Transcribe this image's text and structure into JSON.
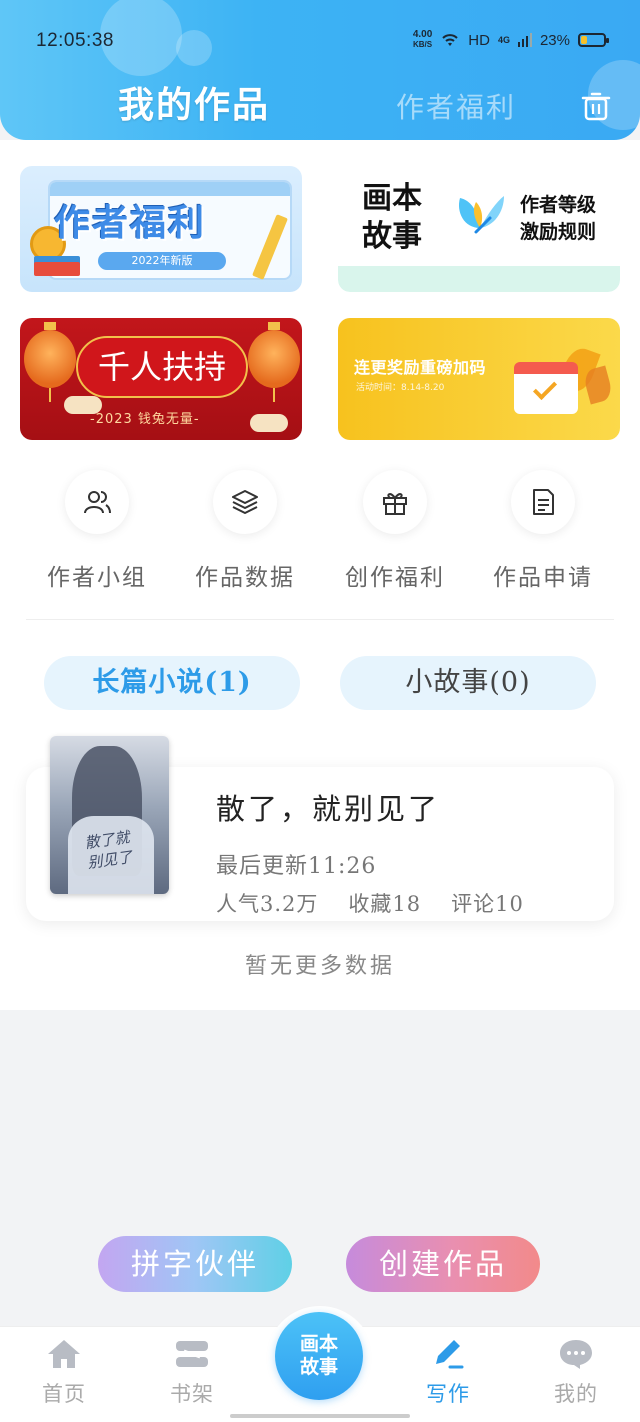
{
  "status_bar": {
    "time": "12:05:38",
    "net_speed_value": "4.00",
    "net_speed_unit": "KB/S",
    "hd": "HD",
    "network": "4G",
    "battery": "23%",
    "battery_level": 0.23
  },
  "header": {
    "tab_my_works": "我的作品",
    "tab_author_benefits": "作者福利",
    "trash_icon": "trash-icon"
  },
  "banners": {
    "author_benefits": {
      "title": "作者福利",
      "tag": "2022年新版"
    },
    "picture_book": {
      "logo": "画本\n故事",
      "text": "作者等级\n激励规则"
    },
    "thousand_support": {
      "title": "千人扶持",
      "subtitle": "-2023 钱兔无量-"
    },
    "update_reward": {
      "title": "连更奖励重磅加码",
      "subtitle": "活动时间：8.14-8.20"
    }
  },
  "quick_actions": [
    {
      "label": "作者小组",
      "icon": "people-icon"
    },
    {
      "label": "作品数据",
      "icon": "layers-icon"
    },
    {
      "label": "创作福利",
      "icon": "gift-icon"
    },
    {
      "label": "作品申请",
      "icon": "document-icon"
    }
  ],
  "subtabs": {
    "novel": "长篇小说(1)",
    "story": "小故事(0)"
  },
  "work": {
    "cover_text": "散了就\n别见了",
    "title": "散了，就别见了",
    "updated": "最后更新11:26",
    "popularity": "人气3.2万",
    "favorites": "收藏18",
    "comments": "评论10"
  },
  "no_more": "暂无更多数据",
  "actions": {
    "partner": "拼字伙伴",
    "create": "创建作品"
  },
  "tabbar": {
    "home": "首页",
    "shelf": "书架",
    "center": "画本\n故事",
    "write": "写作",
    "mine": "我的"
  },
  "colors": {
    "accent": "#2d9be8",
    "header": "#3db3f4"
  }
}
